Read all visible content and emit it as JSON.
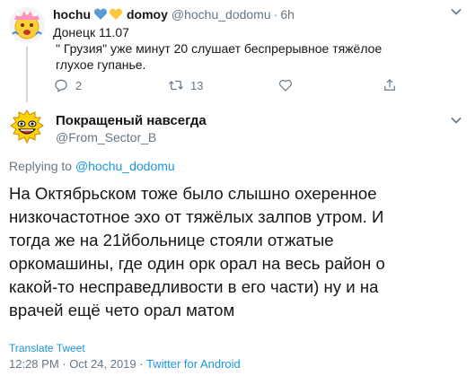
{
  "parent_tweet": {
    "display_name": "hochu",
    "display_name_suffix": "domoy",
    "handle": "@hochu_dodomu",
    "time": "6h",
    "separator": "·",
    "text_line1": "Донецк 11.07",
    "text_line2": "\" Грузия\" уже минут 20 слушает беспрерывное тяжёлое глухое гупанье.",
    "reply_count": "2",
    "retweet_count": "13",
    "heart_colors": [
      "#5b9bd5",
      "#ffc83d"
    ]
  },
  "main_tweet": {
    "display_name": "Покращеный навсегда",
    "handle": "@From_Sector_B",
    "replying_prefix": "Replying to",
    "replying_to": "@hochu_dodomu",
    "text_lines": [
      "На Октябрьском тоже было слышно охеренное",
      "низкочастотное эхо от тяжёлых залпов утром. И",
      "тогда же на 21йбольнице стояли отжатые",
      "оркомашины, где один орк орал на весь район о",
      "какой-то несправедливости в его части) ну и на",
      "врачей ещё чето орал матом"
    ],
    "translate_label": "Translate Tweet",
    "timestamp": "12:28 PM · Oct 24, 2019",
    "meta_separator": "·",
    "source": "Twitter for Android"
  },
  "colors": {
    "text": "#14171a",
    "secondary": "#657786",
    "link": "#1b95e0",
    "divider": "#ccd6dd"
  }
}
